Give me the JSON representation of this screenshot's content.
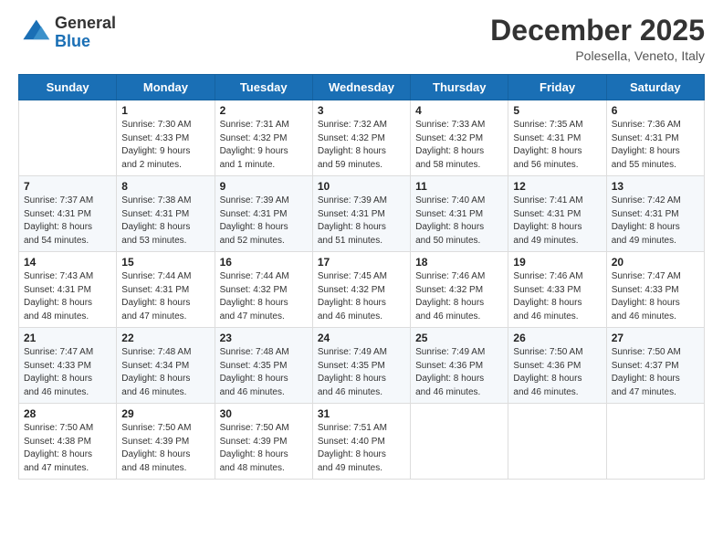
{
  "logo": {
    "line1": "General",
    "line2": "Blue"
  },
  "header": {
    "month": "December 2025",
    "location": "Polesella, Veneto, Italy"
  },
  "weekdays": [
    "Sunday",
    "Monday",
    "Tuesday",
    "Wednesday",
    "Thursday",
    "Friday",
    "Saturday"
  ],
  "weeks": [
    [
      {
        "day": "",
        "info": ""
      },
      {
        "day": "1",
        "info": "Sunrise: 7:30 AM\nSunset: 4:33 PM\nDaylight: 9 hours\nand 2 minutes."
      },
      {
        "day": "2",
        "info": "Sunrise: 7:31 AM\nSunset: 4:32 PM\nDaylight: 9 hours\nand 1 minute."
      },
      {
        "day": "3",
        "info": "Sunrise: 7:32 AM\nSunset: 4:32 PM\nDaylight: 8 hours\nand 59 minutes."
      },
      {
        "day": "4",
        "info": "Sunrise: 7:33 AM\nSunset: 4:32 PM\nDaylight: 8 hours\nand 58 minutes."
      },
      {
        "day": "5",
        "info": "Sunrise: 7:35 AM\nSunset: 4:31 PM\nDaylight: 8 hours\nand 56 minutes."
      },
      {
        "day": "6",
        "info": "Sunrise: 7:36 AM\nSunset: 4:31 PM\nDaylight: 8 hours\nand 55 minutes."
      }
    ],
    [
      {
        "day": "7",
        "info": "Sunrise: 7:37 AM\nSunset: 4:31 PM\nDaylight: 8 hours\nand 54 minutes."
      },
      {
        "day": "8",
        "info": "Sunrise: 7:38 AM\nSunset: 4:31 PM\nDaylight: 8 hours\nand 53 minutes."
      },
      {
        "day": "9",
        "info": "Sunrise: 7:39 AM\nSunset: 4:31 PM\nDaylight: 8 hours\nand 52 minutes."
      },
      {
        "day": "10",
        "info": "Sunrise: 7:39 AM\nSunset: 4:31 PM\nDaylight: 8 hours\nand 51 minutes."
      },
      {
        "day": "11",
        "info": "Sunrise: 7:40 AM\nSunset: 4:31 PM\nDaylight: 8 hours\nand 50 minutes."
      },
      {
        "day": "12",
        "info": "Sunrise: 7:41 AM\nSunset: 4:31 PM\nDaylight: 8 hours\nand 49 minutes."
      },
      {
        "day": "13",
        "info": "Sunrise: 7:42 AM\nSunset: 4:31 PM\nDaylight: 8 hours\nand 49 minutes."
      }
    ],
    [
      {
        "day": "14",
        "info": "Sunrise: 7:43 AM\nSunset: 4:31 PM\nDaylight: 8 hours\nand 48 minutes."
      },
      {
        "day": "15",
        "info": "Sunrise: 7:44 AM\nSunset: 4:31 PM\nDaylight: 8 hours\nand 47 minutes."
      },
      {
        "day": "16",
        "info": "Sunrise: 7:44 AM\nSunset: 4:32 PM\nDaylight: 8 hours\nand 47 minutes."
      },
      {
        "day": "17",
        "info": "Sunrise: 7:45 AM\nSunset: 4:32 PM\nDaylight: 8 hours\nand 46 minutes."
      },
      {
        "day": "18",
        "info": "Sunrise: 7:46 AM\nSunset: 4:32 PM\nDaylight: 8 hours\nand 46 minutes."
      },
      {
        "day": "19",
        "info": "Sunrise: 7:46 AM\nSunset: 4:33 PM\nDaylight: 8 hours\nand 46 minutes."
      },
      {
        "day": "20",
        "info": "Sunrise: 7:47 AM\nSunset: 4:33 PM\nDaylight: 8 hours\nand 46 minutes."
      }
    ],
    [
      {
        "day": "21",
        "info": "Sunrise: 7:47 AM\nSunset: 4:33 PM\nDaylight: 8 hours\nand 46 minutes."
      },
      {
        "day": "22",
        "info": "Sunrise: 7:48 AM\nSunset: 4:34 PM\nDaylight: 8 hours\nand 46 minutes."
      },
      {
        "day": "23",
        "info": "Sunrise: 7:48 AM\nSunset: 4:35 PM\nDaylight: 8 hours\nand 46 minutes."
      },
      {
        "day": "24",
        "info": "Sunrise: 7:49 AM\nSunset: 4:35 PM\nDaylight: 8 hours\nand 46 minutes."
      },
      {
        "day": "25",
        "info": "Sunrise: 7:49 AM\nSunset: 4:36 PM\nDaylight: 8 hours\nand 46 minutes."
      },
      {
        "day": "26",
        "info": "Sunrise: 7:50 AM\nSunset: 4:36 PM\nDaylight: 8 hours\nand 46 minutes."
      },
      {
        "day": "27",
        "info": "Sunrise: 7:50 AM\nSunset: 4:37 PM\nDaylight: 8 hours\nand 47 minutes."
      }
    ],
    [
      {
        "day": "28",
        "info": "Sunrise: 7:50 AM\nSunset: 4:38 PM\nDaylight: 8 hours\nand 47 minutes."
      },
      {
        "day": "29",
        "info": "Sunrise: 7:50 AM\nSunset: 4:39 PM\nDaylight: 8 hours\nand 48 minutes."
      },
      {
        "day": "30",
        "info": "Sunrise: 7:50 AM\nSunset: 4:39 PM\nDaylight: 8 hours\nand 48 minutes."
      },
      {
        "day": "31",
        "info": "Sunrise: 7:51 AM\nSunset: 4:40 PM\nDaylight: 8 hours\nand 49 minutes."
      },
      {
        "day": "",
        "info": ""
      },
      {
        "day": "",
        "info": ""
      },
      {
        "day": "",
        "info": ""
      }
    ]
  ]
}
